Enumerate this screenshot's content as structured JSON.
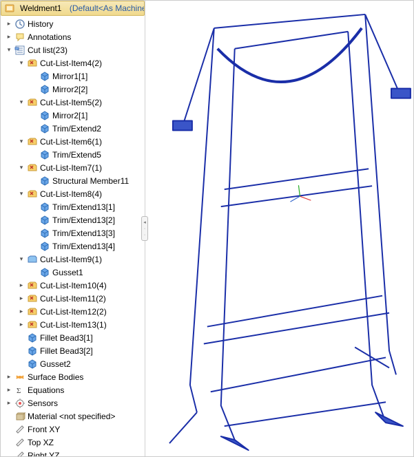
{
  "header": {
    "title": "Weldment1",
    "config": "(Default<As Machined><"
  },
  "tree": [
    {
      "depth": 0,
      "toggle": "closed",
      "icon": "history-icon",
      "label": "History",
      "interact": true
    },
    {
      "depth": 0,
      "toggle": "closed",
      "icon": "annotations-icon",
      "label": "Annotations",
      "interact": true
    },
    {
      "depth": 0,
      "toggle": "open",
      "icon": "cutlist-icon",
      "label": "Cut list(23)",
      "interact": true
    },
    {
      "depth": 1,
      "toggle": "open",
      "icon": "cutfolder-icon",
      "label": "Cut-List-Item4(2)",
      "interact": true
    },
    {
      "depth": 2,
      "toggle": "none",
      "icon": "body-icon",
      "label": "Mirror1[1]",
      "interact": true
    },
    {
      "depth": 2,
      "toggle": "none",
      "icon": "body-icon",
      "label": "Mirror2[2]",
      "interact": true
    },
    {
      "depth": 1,
      "toggle": "open",
      "icon": "cutfolder-icon",
      "label": "Cut-List-Item5(2)",
      "interact": true
    },
    {
      "depth": 2,
      "toggle": "none",
      "icon": "body-icon",
      "label": "Mirror2[1]",
      "interact": true
    },
    {
      "depth": 2,
      "toggle": "none",
      "icon": "body-icon",
      "label": "Trim/Extend2",
      "interact": true
    },
    {
      "depth": 1,
      "toggle": "open",
      "icon": "cutfolder-icon",
      "label": "Cut-List-Item6(1)",
      "interact": true
    },
    {
      "depth": 2,
      "toggle": "none",
      "icon": "body-icon",
      "label": "Trim/Extend5",
      "interact": true
    },
    {
      "depth": 1,
      "toggle": "open",
      "icon": "cutfolder-icon",
      "label": "Cut-List-Item7(1)",
      "interact": true
    },
    {
      "depth": 2,
      "toggle": "none",
      "icon": "body-icon",
      "label": "Structural Member11",
      "interact": true
    },
    {
      "depth": 1,
      "toggle": "open",
      "icon": "cutfolder-icon",
      "label": "Cut-List-Item8(4)",
      "interact": true
    },
    {
      "depth": 2,
      "toggle": "none",
      "icon": "body-icon",
      "label": "Trim/Extend13[1]",
      "interact": true
    },
    {
      "depth": 2,
      "toggle": "none",
      "icon": "body-icon",
      "label": "Trim/Extend13[2]",
      "interact": true
    },
    {
      "depth": 2,
      "toggle": "none",
      "icon": "body-icon",
      "label": "Trim/Extend13[3]",
      "interact": true
    },
    {
      "depth": 2,
      "toggle": "none",
      "icon": "body-icon",
      "label": "Trim/Extend13[4]",
      "interact": true
    },
    {
      "depth": 1,
      "toggle": "open",
      "icon": "folder-icon",
      "label": "Cut-List-Item9(1)",
      "interact": true
    },
    {
      "depth": 2,
      "toggle": "none",
      "icon": "body-icon",
      "label": "Gusset1",
      "interact": true
    },
    {
      "depth": 1,
      "toggle": "closed",
      "icon": "cutfolder-icon",
      "label": "Cut-List-Item10(4)",
      "interact": true
    },
    {
      "depth": 1,
      "toggle": "closed",
      "icon": "cutfolder-icon",
      "label": "Cut-List-Item11(2)",
      "interact": true
    },
    {
      "depth": 1,
      "toggle": "closed",
      "icon": "cutfolder-icon",
      "label": "Cut-List-Item12(2)",
      "interact": true
    },
    {
      "depth": 1,
      "toggle": "closed",
      "icon": "cutfolder-icon",
      "label": "Cut-List-Item13(1)",
      "interact": true
    },
    {
      "depth": 1,
      "toggle": "none",
      "icon": "body-icon",
      "label": "Fillet Bead3[1]",
      "interact": true
    },
    {
      "depth": 1,
      "toggle": "none",
      "icon": "body-icon",
      "label": "Fillet Bead3[2]",
      "interact": true
    },
    {
      "depth": 1,
      "toggle": "none",
      "icon": "body-icon",
      "label": "Gusset2",
      "interact": true
    },
    {
      "depth": 0,
      "toggle": "closed",
      "icon": "surface-icon",
      "label": "Surface Bodies",
      "interact": true
    },
    {
      "depth": 0,
      "toggle": "closed",
      "icon": "equations-icon",
      "label": "Equations",
      "interact": true
    },
    {
      "depth": 0,
      "toggle": "closed",
      "icon": "sensors-icon",
      "label": "Sensors",
      "interact": true
    },
    {
      "depth": 0,
      "toggle": "none",
      "icon": "material-icon",
      "label": "Material <not specified>",
      "interact": true
    },
    {
      "depth": 0,
      "toggle": "none",
      "icon": "plane-icon",
      "label": "Front XY",
      "interact": true
    },
    {
      "depth": 0,
      "toggle": "none",
      "icon": "plane-icon",
      "label": "Top XZ",
      "interact": true
    },
    {
      "depth": 0,
      "toggle": "none",
      "icon": "plane-icon",
      "label": "Right YZ",
      "interact": true
    }
  ]
}
